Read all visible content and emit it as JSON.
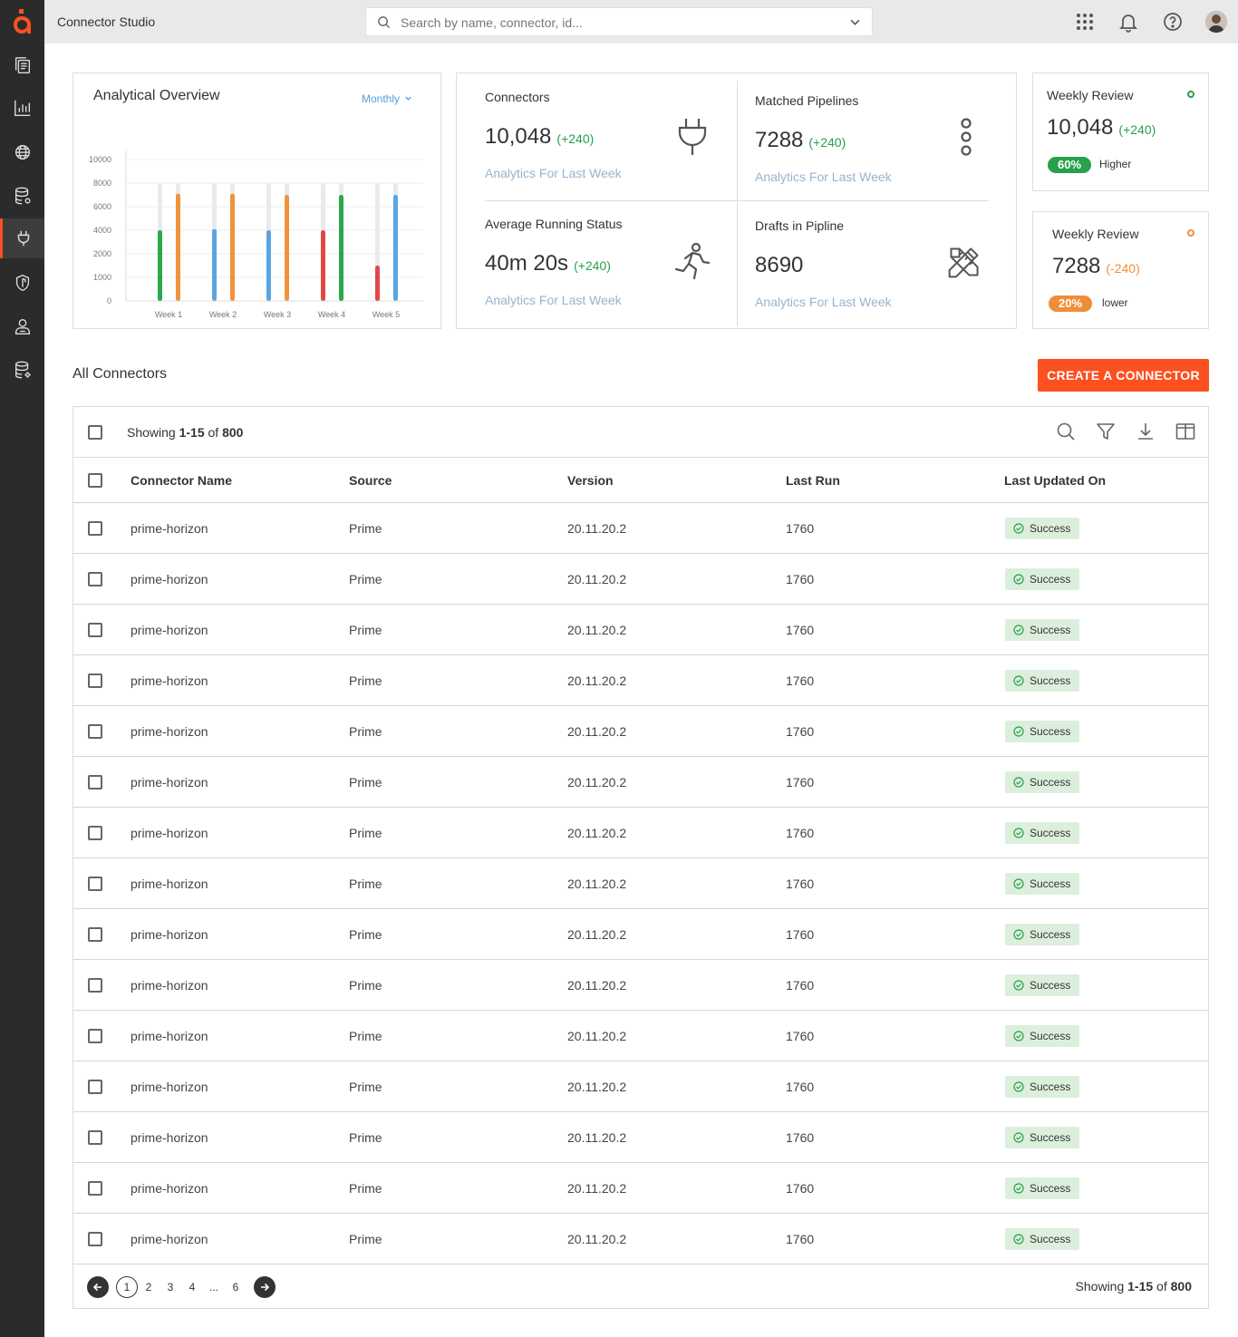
{
  "app": {
    "title": "Connector Studio",
    "brand_color": "#fc5020",
    "logo_text": "a"
  },
  "search": {
    "placeholder": "Search by name, connector, id..."
  },
  "sidebar": {
    "items": [
      {
        "icon": "documents-icon"
      },
      {
        "icon": "bar-chart-icon"
      },
      {
        "icon": "globe-icon"
      },
      {
        "icon": "database-settings-icon"
      },
      {
        "icon": "plug-icon",
        "active": true
      },
      {
        "icon": "shield-icon"
      },
      {
        "icon": "user-badge-icon"
      },
      {
        "icon": "database-gear-icon"
      }
    ]
  },
  "topbar_icons": [
    "apps-grid-icon",
    "bell-icon",
    "help-icon",
    "avatar"
  ],
  "overview": {
    "title": "Analytical Overview",
    "period": "Monthly"
  },
  "chart_data": {
    "type": "bar",
    "categories": [
      "Week 1",
      "Week 2",
      "Week 3",
      "Week 4",
      "Week 5"
    ],
    "y_ticks": [
      "10000",
      "8000",
      "6000",
      "4000",
      "2000",
      "1000",
      "0"
    ],
    "track_max": 8000,
    "series": [
      {
        "values": [
          4000,
          4100,
          4000,
          4000,
          1500
        ],
        "colors": [
          "#2aa84a",
          "#5aa5e0",
          "#5aa5e0",
          "#e04848",
          "#e04848"
        ]
      },
      {
        "values": [
          7100,
          7100,
          7000,
          7000,
          7000
        ],
        "colors": [
          "#f0933c",
          "#f0933c",
          "#f0933c",
          "#2aa84a",
          "#5aa5e0"
        ]
      }
    ],
    "grid": true,
    "track_color": "#e8eaed"
  },
  "stats": {
    "connectors": {
      "label": "Connectors",
      "value": "10,048",
      "delta": "(+240)",
      "sub": "Analytics For Last Week"
    },
    "pipelines": {
      "label": "Matched Pipelines",
      "value": "7288",
      "delta": "(+240)",
      "sub": "Analytics For Last Week"
    },
    "running": {
      "label": "Average Running Status",
      "value": "40m 20s",
      "delta": "(+240)",
      "sub": "Analytics For Last Week"
    },
    "drafts": {
      "label": "Drafts in Pipline",
      "value": "8690",
      "sub": "Analytics For Last Week"
    }
  },
  "weekly": [
    {
      "title": "Weekly Review",
      "value": "10,048",
      "delta": "(+240)",
      "pill": "60%",
      "pill_color": "#27a14b",
      "note": "Higher",
      "dot_color": "#27a14b"
    },
    {
      "title": "Weekly Review",
      "value": "7288",
      "delta": "(-240)",
      "pill": "20%",
      "pill_color": "#ef8e38",
      "note": "lower",
      "dot_color": "#ef8e38"
    }
  ],
  "connectors": {
    "title": "All Connectors",
    "create_label": "CREATE A CONNECTOR",
    "showing_prefix": "Showing ",
    "showing_range": "1-15",
    "showing_of": " of ",
    "showing_total": "800",
    "columns": [
      "Connector Name",
      "Source",
      "Version",
      "Last Run",
      "Last Updated On"
    ],
    "rows": [
      {
        "name": "prime-horizon",
        "source": "Prime",
        "version": "20.11.20.2",
        "last_run": "1760",
        "status": "Success"
      },
      {
        "name": "prime-horizon",
        "source": "Prime",
        "version": "20.11.20.2",
        "last_run": "1760",
        "status": "Success"
      },
      {
        "name": "prime-horizon",
        "source": "Prime",
        "version": "20.11.20.2",
        "last_run": "1760",
        "status": "Success"
      },
      {
        "name": "prime-horizon",
        "source": "Prime",
        "version": "20.11.20.2",
        "last_run": "1760",
        "status": "Success"
      },
      {
        "name": "prime-horizon",
        "source": "Prime",
        "version": "20.11.20.2",
        "last_run": "1760",
        "status": "Success"
      },
      {
        "name": "prime-horizon",
        "source": "Prime",
        "version": "20.11.20.2",
        "last_run": "1760",
        "status": "Success"
      },
      {
        "name": "prime-horizon",
        "source": "Prime",
        "version": "20.11.20.2",
        "last_run": "1760",
        "status": "Success"
      },
      {
        "name": "prime-horizon",
        "source": "Prime",
        "version": "20.11.20.2",
        "last_run": "1760",
        "status": "Success"
      },
      {
        "name": "prime-horizon",
        "source": "Prime",
        "version": "20.11.20.2",
        "last_run": "1760",
        "status": "Success"
      },
      {
        "name": "prime-horizon",
        "source": "Prime",
        "version": "20.11.20.2",
        "last_run": "1760",
        "status": "Success"
      },
      {
        "name": "prime-horizon",
        "source": "Prime",
        "version": "20.11.20.2",
        "last_run": "1760",
        "status": "Success"
      },
      {
        "name": "prime-horizon",
        "source": "Prime",
        "version": "20.11.20.2",
        "last_run": "1760",
        "status": "Success"
      },
      {
        "name": "prime-horizon",
        "source": "Prime",
        "version": "20.11.20.2",
        "last_run": "1760",
        "status": "Success"
      },
      {
        "name": "prime-horizon",
        "source": "Prime",
        "version": "20.11.20.2",
        "last_run": "1760",
        "status": "Success"
      },
      {
        "name": "prime-horizon",
        "source": "Prime",
        "version": "20.11.20.2",
        "last_run": "1760",
        "status": "Success"
      }
    ],
    "status_color": "#dcefdd"
  },
  "pagination": {
    "pages": [
      "1",
      "2",
      "3",
      "4",
      "...",
      "6"
    ],
    "current": "1"
  }
}
